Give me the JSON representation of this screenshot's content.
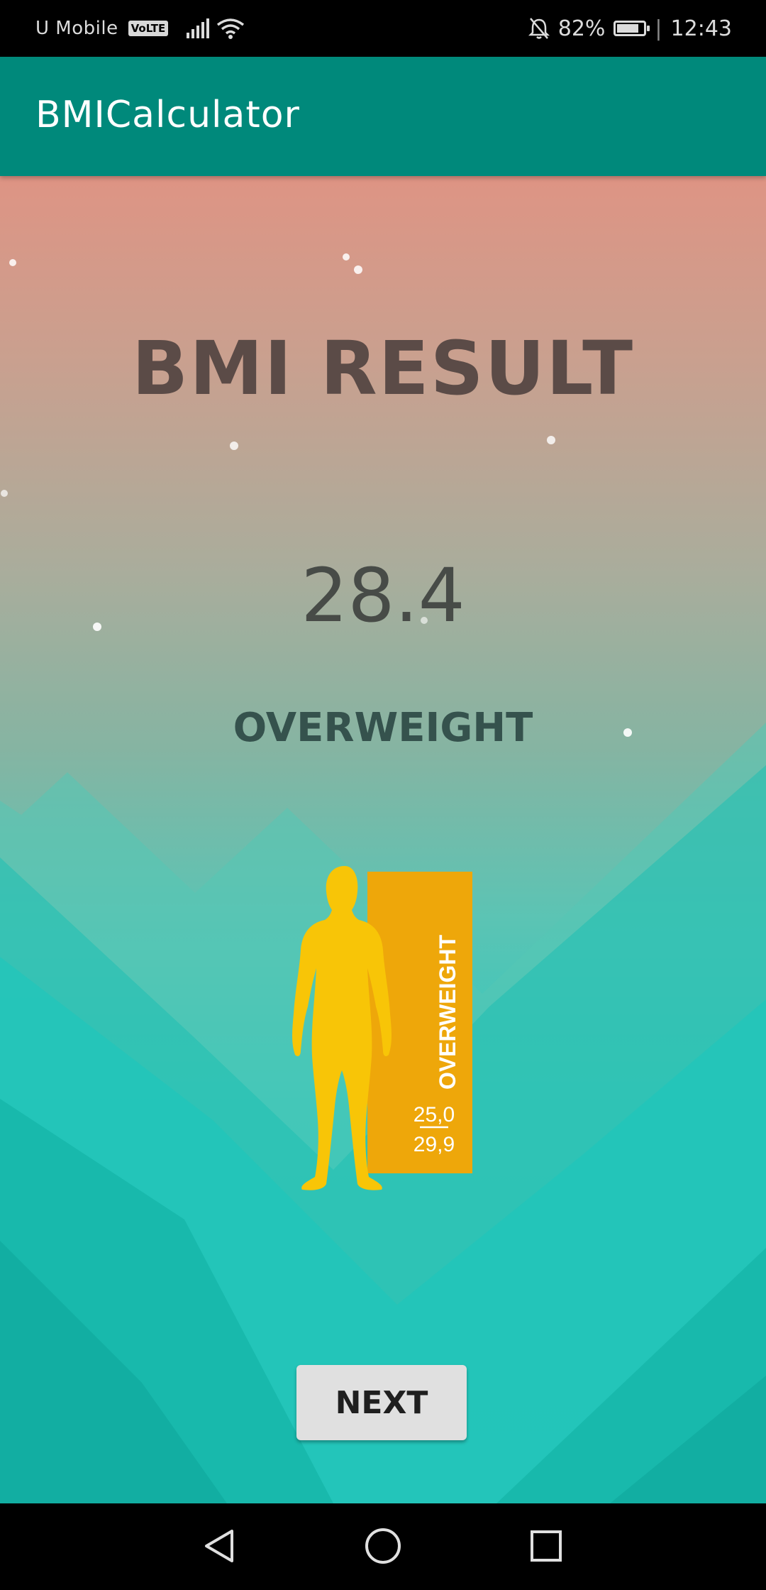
{
  "status_bar": {
    "carrier": "U Mobile",
    "volte_badge": "VoLTE",
    "battery_percent": "82%",
    "battery_level": 0.82,
    "time": "12:43",
    "icons": [
      "signal-icon",
      "wifi-icon",
      "alarm-off-icon",
      "battery-icon"
    ]
  },
  "app_bar": {
    "title": "BMICalculator",
    "color": "#00897b"
  },
  "result": {
    "heading": "BMI RESULT",
    "bmi_value": "28.4",
    "category": "OVERWEIGHT"
  },
  "figure": {
    "banner_label": "OVERWEIGHT",
    "range_low": "25,0",
    "range_high": "29,9",
    "colors": {
      "body": "#f8c507",
      "banner": "#eea70a"
    }
  },
  "actions": {
    "next_label": "NEXT"
  },
  "nav_bar": {
    "icons": [
      "back-triangle-icon",
      "home-circle-icon",
      "recents-square-icon"
    ]
  }
}
